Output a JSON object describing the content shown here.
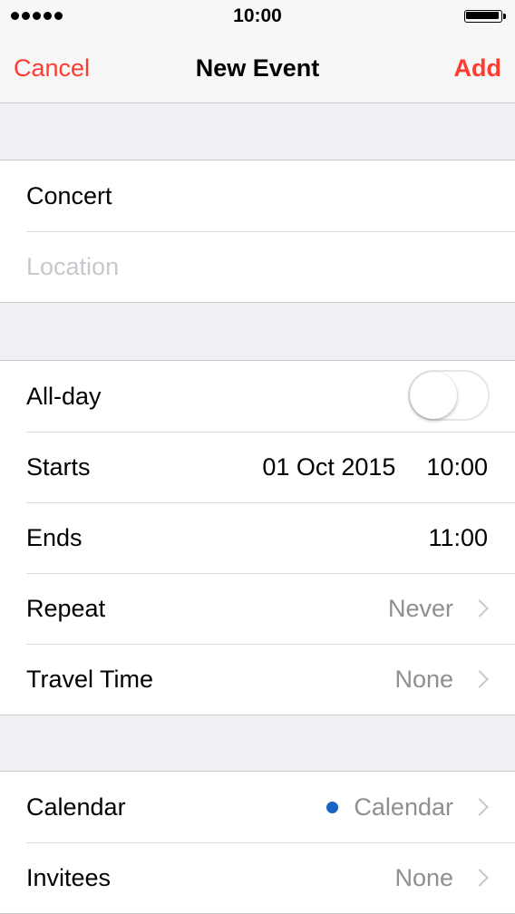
{
  "status_bar": {
    "time": "10:00",
    "signal_icon": "signal-dots-icon",
    "battery_icon": "battery-full-icon"
  },
  "nav": {
    "cancel_label": "Cancel",
    "title": "New Event",
    "add_label": "Add"
  },
  "event": {
    "title_value": "Concert",
    "location_placeholder": "Location"
  },
  "schedule": {
    "allday_label": "All-day",
    "allday_on": false,
    "starts_label": "Starts",
    "starts_date": "01 Oct 2015",
    "starts_time": "10:00",
    "ends_label": "Ends",
    "ends_time": "11:00",
    "repeat_label": "Repeat",
    "repeat_value": "Never",
    "travel_label": "Travel Time",
    "travel_value": "None"
  },
  "details": {
    "calendar_label": "Calendar",
    "calendar_value": "Calendar",
    "calendar_color": "#1a64c4",
    "invitees_label": "Invitees",
    "invitees_value": "None"
  },
  "colors": {
    "accent": "#ff3b30",
    "background": "#efeff4",
    "secondary_text": "#8e8e93"
  }
}
